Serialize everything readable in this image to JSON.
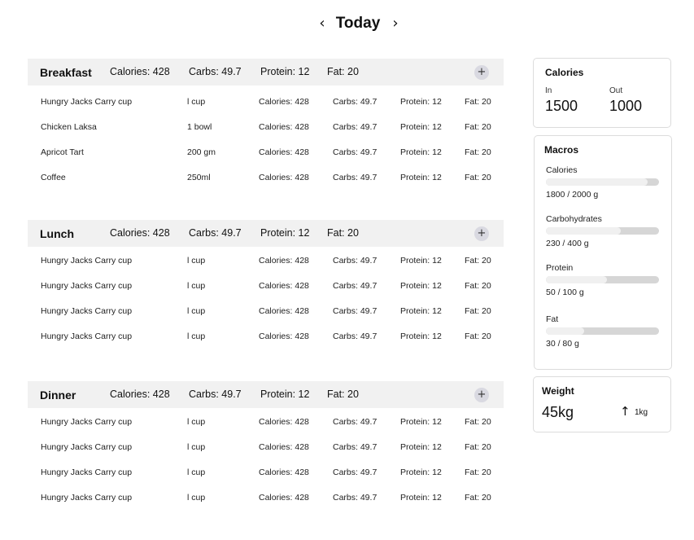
{
  "nav": {
    "title": "Today",
    "prev_icon": "‹",
    "next_icon": "›"
  },
  "meals": [
    {
      "name": "Breakfast",
      "summary": {
        "calories": "Calories: 428",
        "carbs": "Carbs: 49.7",
        "protein": "Protein: 12",
        "fat": "Fat: 20"
      },
      "add_icon": "+",
      "items": [
        {
          "name": "Hungry Jacks Carry cup",
          "qty": "l cup",
          "calories": "Calories: 428",
          "carbs": "Carbs: 49.7",
          "protein": "Protein: 12",
          "fat": "Fat: 20"
        },
        {
          "name": "Chicken Laksa",
          "qty": "1 bowl",
          "calories": "Calories: 428",
          "carbs": "Carbs: 49.7",
          "protein": "Protein: 12",
          "fat": "Fat: 20"
        },
        {
          "name": "Apricot Tart",
          "qty": "200 gm",
          "calories": "Calories: 428",
          "carbs": "Carbs: 49.7",
          "protein": "Protein: 12",
          "fat": "Fat: 20"
        },
        {
          "name": "Coffee",
          "qty": "250ml",
          "calories": "Calories: 428",
          "carbs": "Carbs: 49.7",
          "protein": "Protein: 12",
          "fat": "Fat: 20"
        }
      ]
    },
    {
      "name": "Lunch",
      "summary": {
        "calories": "Calories: 428",
        "carbs": "Carbs: 49.7",
        "protein": "Protein: 12",
        "fat": "Fat: 20"
      },
      "add_icon": "+",
      "items": [
        {
          "name": "Hungry Jacks Carry cup",
          "qty": "l cup",
          "calories": "Calories: 428",
          "carbs": "Carbs: 49.7",
          "protein": "Protein: 12",
          "fat": "Fat: 20"
        },
        {
          "name": "Hungry Jacks Carry cup",
          "qty": "l cup",
          "calories": "Calories: 428",
          "carbs": "Carbs: 49.7",
          "protein": "Protein: 12",
          "fat": "Fat: 20"
        },
        {
          "name": "Hungry Jacks Carry cup",
          "qty": "l cup",
          "calories": "Calories: 428",
          "carbs": "Carbs: 49.7",
          "protein": "Protein: 12",
          "fat": "Fat: 20"
        },
        {
          "name": "Hungry Jacks Carry cup",
          "qty": "l cup",
          "calories": "Calories: 428",
          "carbs": "Carbs: 49.7",
          "protein": "Protein: 12",
          "fat": "Fat: 20"
        }
      ]
    },
    {
      "name": "Dinner",
      "summary": {
        "calories": "Calories: 428",
        "carbs": "Carbs: 49.7",
        "protein": "Protein: 12",
        "fat": "Fat: 20"
      },
      "add_icon": "+",
      "items": [
        {
          "name": "Hungry Jacks Carry cup",
          "qty": "l cup",
          "calories": "Calories: 428",
          "carbs": "Carbs: 49.7",
          "protein": "Protein: 12",
          "fat": "Fat: 20"
        },
        {
          "name": "Hungry Jacks Carry cup",
          "qty": "l cup",
          "calories": "Calories: 428",
          "carbs": "Carbs: 49.7",
          "protein": "Protein: 12",
          "fat": "Fat: 20"
        },
        {
          "name": "Hungry Jacks Carry cup",
          "qty": "l cup",
          "calories": "Calories: 428",
          "carbs": "Carbs: 49.7",
          "protein": "Protein: 12",
          "fat": "Fat: 20"
        },
        {
          "name": "Hungry Jacks Carry cup",
          "qty": "l cup",
          "calories": "Calories: 428",
          "carbs": "Carbs: 49.7",
          "protein": "Protein: 12",
          "fat": "Fat: 20"
        }
      ]
    }
  ],
  "calories_card": {
    "title": "Calories",
    "in_label": "In",
    "in_value": "1500",
    "out_label": "Out",
    "out_value": "1000"
  },
  "macros_card": {
    "title": "Macros",
    "items": [
      {
        "label": "Calories",
        "value": "1800 / 2000 g",
        "progress": 0.9
      },
      {
        "label": "Carbohydrates",
        "value": "230 / 400 g",
        "progress": 0.66
      },
      {
        "label": "Protein",
        "value": "50 / 100 g",
        "progress": 0.54
      },
      {
        "label": "Fat",
        "value": " 30 / 80 g",
        "progress": 0.34
      }
    ]
  },
  "weight_card": {
    "title": "Weight",
    "value": "45kg",
    "trend_icon": "↑",
    "change": "1kg"
  },
  "colors": {
    "header_bg": "#f1f1f1",
    "add_button": "#d9d9e1",
    "bar_track": "#d6d6d6",
    "bar_fill": "#f0f0f0",
    "card_border": "#dcdcdc"
  }
}
